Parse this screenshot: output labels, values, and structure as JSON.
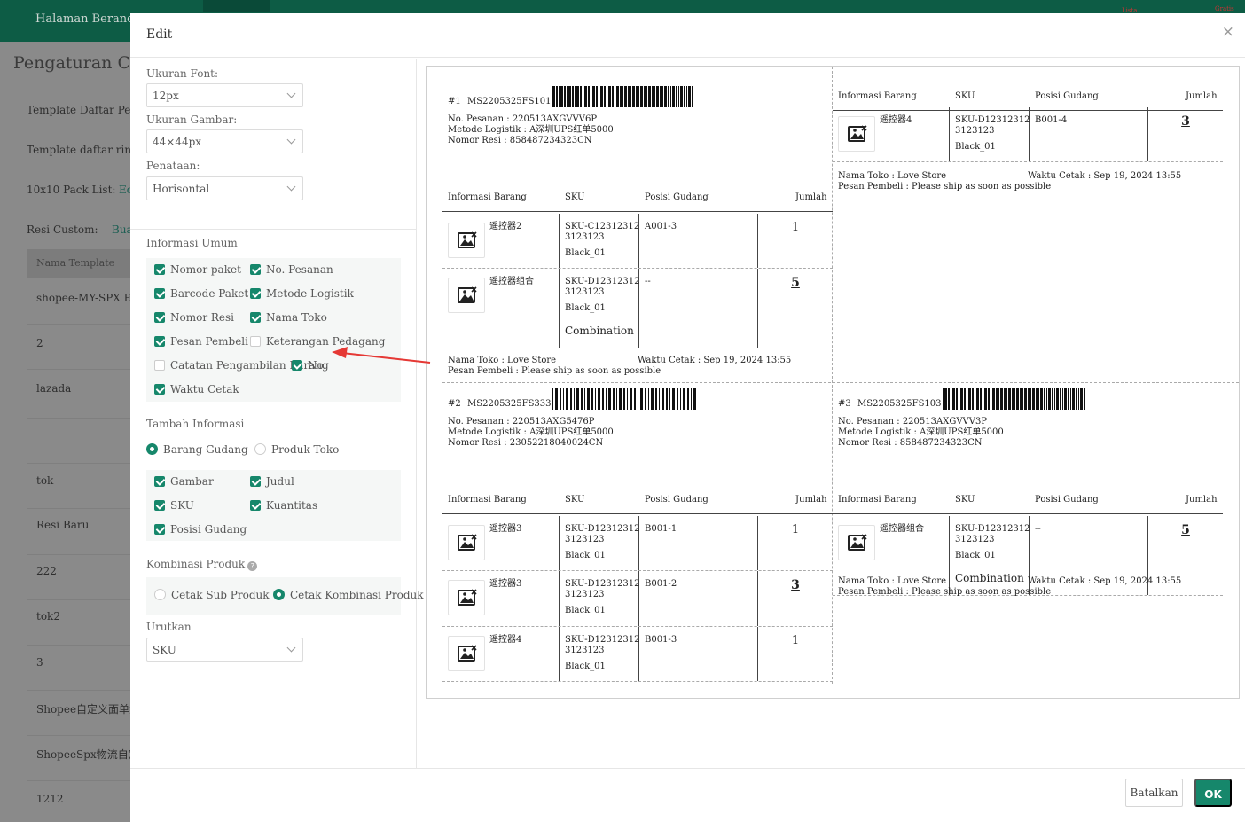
{
  "background": {
    "home": "Halaman Beranda",
    "page_title": "Pengaturan Ceta",
    "labels": [
      "Template Daftar Pengar",
      "Template daftar ringkas",
      "10x10 Pack List:",
      "Resi Custom:"
    ],
    "link_ed": "Ed",
    "link_bua": "Bua",
    "table_head": "Nama Template",
    "rows": [
      "shopee-MY-SPX Expr",
      "2",
      "lazada",
      "tok",
      "Resi Baru",
      "222",
      "tok2",
      "3",
      "Shopee自定义面单测",
      "ShopeeSpx物流自定义",
      "1212"
    ],
    "mini1": "Lista",
    "mini2": "Gratis"
  },
  "modal": {
    "title": "Edit",
    "close": "×",
    "font_size_label": "Ukuran Font:",
    "font_size_value": "12px",
    "image_size_label": "Ukuran Gambar:",
    "image_size_value": "44×44px",
    "layout_label": "Penataan:",
    "layout_value": "Horisontal",
    "general_title": "Informasi Umum",
    "general": {
      "nomor_paket": "Nomor paket",
      "no_pesanan": "No. Pesanan",
      "barcode_paket": "Barcode Paket",
      "metode_logistik": "Metode Logistik",
      "nomor_resi": "Nomor Resi",
      "nama_toko": "Nama Toko",
      "pesan_pembeli": "Pesan Pembeli",
      "keterangan_pedagang": "Keterangan Pedagang",
      "catatan": "Catatan Pengambilan Barang",
      "no": "No.",
      "waktu_cetak": "Waktu Cetak"
    },
    "extra_title": "Tambah Informasi",
    "extra_radio": {
      "gudang": "Barang Gudang",
      "toko": "Produk Toko"
    },
    "extra": {
      "gambar": "Gambar",
      "judul": "Judul",
      "sku": "SKU",
      "kuantitas": "Kuantitas",
      "posisi": "Posisi Gudang"
    },
    "combo_title": "Kombinasi Produk",
    "combo_help": "?",
    "combo": {
      "sub": "Cetak Sub Produk",
      "kombinasi": "Cetak Kombinasi Produk"
    },
    "sort_label": "Urutkan",
    "sort_value": "SKU",
    "cancel": "Batalkan",
    "ok": "OK"
  },
  "preview": {
    "col_headers": {
      "info": "Informasi Barang",
      "sku": "SKU",
      "pos": "Posisi Gudang",
      "qty": "Jumlah"
    },
    "packages": [
      {
        "num": "#1",
        "code": "MS2205325FS101",
        "order": "No. Pesanan : 220513AXGVVV6P",
        "logistic": "Metode Logistik : A深圳UPS红单5000",
        "resi": "Nomor Resi : 858487234323CN",
        "shop": "Nama Toko : Love Store",
        "msg": "Pesan Pembeli : Please ship as soon as possible",
        "time": "Waktu Cetak : Sep 19, 2024 13:55",
        "items": [
          {
            "name": "遥控器2",
            "sku1": "SKU-C12312312",
            "sku2": "3123123",
            "var": "Black_01",
            "comb": "",
            "pos": "A001-3",
            "qty": "1"
          },
          {
            "name": "遥控器组合",
            "sku1": "SKU-D12312312",
            "sku2": "3123123",
            "var": "Black_01",
            "comb": "Combination",
            "pos": "--",
            "qty": "5"
          }
        ]
      },
      {
        "num": "",
        "code": "",
        "order": "",
        "logistic": "",
        "resi": "",
        "shop": "Nama Toko : Love Store",
        "msg": "Pesan Pembeli : Please ship as soon as possible",
        "time": "Waktu Cetak : Sep 19, 2024 13:55",
        "items": [
          {
            "name": "遥控器4",
            "sku1": "SKU-D12312312",
            "sku2": "3123123",
            "var": "Black_01",
            "comb": "",
            "pos": "B001-4",
            "qty": "3"
          }
        ]
      },
      {
        "num": "#2",
        "code": "MS2205325FS333",
        "order": "No. Pesanan : 220513AXG5476P",
        "logistic": "Metode Logistik : A深圳UPS红单5000",
        "resi": "Nomor Resi : 23052218040024CN",
        "shop": "",
        "msg": "",
        "time": "",
        "items": [
          {
            "name": "遥控器3",
            "sku1": "SKU-D12312312",
            "sku2": "3123123",
            "var": "Black_01",
            "comb": "",
            "pos": "B001-1",
            "qty": "1"
          },
          {
            "name": "遥控器3",
            "sku1": "SKU-D12312312",
            "sku2": "3123123",
            "var": "Black_01",
            "comb": "",
            "pos": "B001-2",
            "qty": "3"
          },
          {
            "name": "遥控器4",
            "sku1": "SKU-D12312312",
            "sku2": "3123123",
            "var": "Black_01",
            "comb": "",
            "pos": "B001-3",
            "qty": "1"
          }
        ]
      },
      {
        "num": "#3",
        "code": "MS2205325FS103",
        "order": "No. Pesanan : 220513AXGVVV3P",
        "logistic": "Metode Logistik : A深圳UPS红单5000",
        "resi": "Nomor Resi : 858487234323CN",
        "shop": "Nama Toko : Love Store",
        "msg": "Pesan Pembeli : Please ship as soon as possible",
        "time": "Waktu Cetak : Sep 19, 2024 13:55",
        "items": [
          {
            "name": "遥控器组合",
            "sku1": "SKU-D12312312",
            "sku2": "3123123",
            "var": "Black_01",
            "comb": "Combination",
            "pos": "--",
            "qty": "5"
          }
        ]
      }
    ]
  },
  "colors": {
    "brand": "#16876b",
    "arrow": "#e53935"
  }
}
